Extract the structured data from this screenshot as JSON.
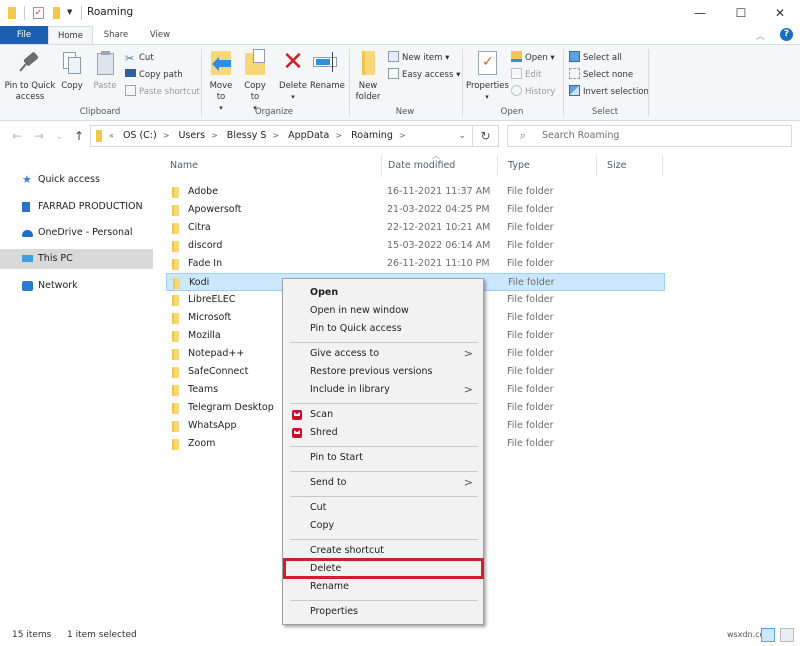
{
  "titlebar": {
    "title": "Roaming",
    "quick_access_icons": [
      "folder-icon",
      "properties-icon",
      "new-folder-icon",
      "customize-dropdown-icon"
    ],
    "controls": {
      "minimize": "—",
      "maximize": "☐",
      "close": "✕"
    }
  },
  "tabs": [
    {
      "label": "File",
      "active": false
    },
    {
      "label": "Home",
      "active": true
    },
    {
      "label": "Share",
      "active": false
    },
    {
      "label": "View",
      "active": false
    }
  ],
  "ribbon": {
    "clipboard": {
      "label": "Clipboard",
      "pin": "Pin to Quick access",
      "copy": "Copy",
      "paste": "Paste",
      "cut": "Cut",
      "copy_path": "Copy path",
      "paste_shortcut": "Paste shortcut"
    },
    "organize": {
      "label": "Organize",
      "move_to": "Move to",
      "copy_to": "Copy to",
      "delete": "Delete",
      "rename": "Rename"
    },
    "new": {
      "label": "New",
      "new_folder": "New folder",
      "new_item": "New item",
      "easy_access": "Easy access"
    },
    "open": {
      "label": "Open",
      "properties": "Properties",
      "open": "Open",
      "edit": "Edit",
      "history": "History"
    },
    "select": {
      "label": "Select",
      "select_all": "Select all",
      "select_none": "Select none",
      "invert_selection": "Invert selection"
    }
  },
  "address": {
    "breadcrumbs": [
      "«",
      "OS (C:)",
      "Users",
      "Blessy S",
      "AppData",
      "Roaming"
    ],
    "search_placeholder": "Search Roaming"
  },
  "sidebar": {
    "items": [
      {
        "label": "Quick access",
        "icon": "star-icon"
      },
      {
        "label": "FARRAD PRODUCTION",
        "icon": "building-icon"
      },
      {
        "label": "OneDrive - Personal",
        "icon": "cloud-icon"
      },
      {
        "label": "This PC",
        "icon": "computer-icon",
        "selected": true
      },
      {
        "label": "Network",
        "icon": "network-icon"
      }
    ]
  },
  "columns": {
    "name": "Name",
    "date": "Date modified",
    "type": "Type",
    "size": "Size"
  },
  "files": [
    {
      "name": "Adobe",
      "date": "16-11-2021 11:37 AM",
      "type": "File folder"
    },
    {
      "name": "Apowersoft",
      "date": "21-03-2022 04:25 PM",
      "type": "File folder"
    },
    {
      "name": "Citra",
      "date": "22-12-2021 10:21 AM",
      "type": "File folder"
    },
    {
      "name": "discord",
      "date": "15-03-2022 06:14 AM",
      "type": "File folder"
    },
    {
      "name": "Fade In",
      "date": "26-11-2021 11:10 PM",
      "type": "File folder"
    },
    {
      "name": "Kodi",
      "date": "",
      "type": "File folder",
      "selected": true
    },
    {
      "name": "LibreELEC",
      "date": "",
      "type": "File folder"
    },
    {
      "name": "Microsoft",
      "date": "",
      "type": "File folder"
    },
    {
      "name": "Mozilla",
      "date": "",
      "type": "File folder"
    },
    {
      "name": "Notepad++",
      "date": "",
      "type": "File folder"
    },
    {
      "name": "SafeConnect",
      "date": "",
      "type": "File folder"
    },
    {
      "name": "Teams",
      "date": "",
      "type": "File folder"
    },
    {
      "name": "Telegram Desktop",
      "date": "",
      "type": "File folder"
    },
    {
      "name": "WhatsApp",
      "date": "",
      "type": "File folder"
    },
    {
      "name": "Zoom",
      "date": "",
      "type": "File folder"
    }
  ],
  "context_menu": {
    "items": [
      {
        "label": "Open",
        "bold": true
      },
      {
        "label": "Open in new window"
      },
      {
        "label": "Pin to Quick access"
      },
      {
        "label": "Give access to",
        "submenu": true
      },
      {
        "label": "Restore previous versions"
      },
      {
        "label": "Include in library",
        "submenu": true
      },
      {
        "label": "Scan",
        "icon": "mcafee-icon"
      },
      {
        "label": "Shred",
        "icon": "mcafee-icon"
      },
      {
        "label": "Pin to Start"
      },
      {
        "label": "Send to",
        "submenu": true
      },
      {
        "label": "Cut"
      },
      {
        "label": "Copy"
      },
      {
        "label": "Create shortcut"
      },
      {
        "label": "Delete",
        "highlighted": true
      },
      {
        "label": "Rename"
      },
      {
        "label": "Properties"
      }
    ],
    "highlight_color": "#d0202e"
  },
  "status": {
    "item_count": "15 items",
    "selection": "1 item selected",
    "watermark": "wsxdn.com"
  }
}
